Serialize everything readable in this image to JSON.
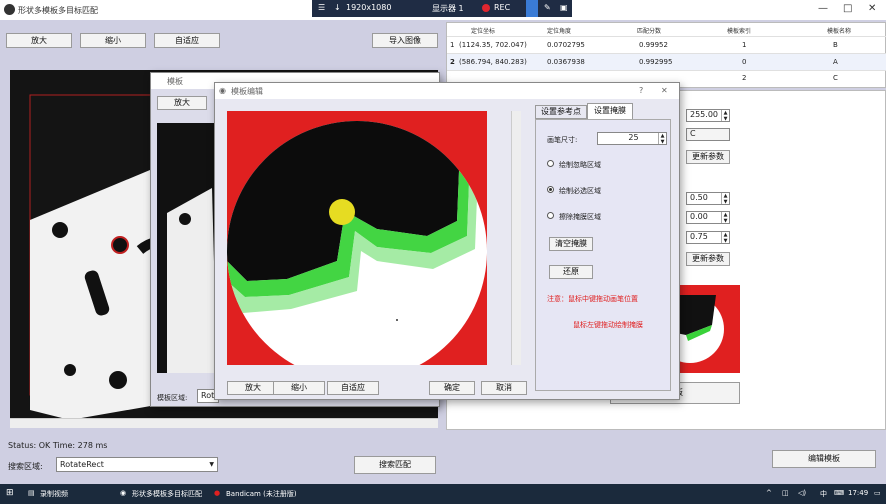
{
  "titlebar": {
    "title": "形状多模板多目标匹配",
    "minimize": "—",
    "maximize": "□",
    "close": "✕"
  },
  "recorder": {
    "resolution": "1920x1080",
    "display": "显示器 1",
    "rec": "REC"
  },
  "toolbar": {
    "zoom_in": "放大",
    "zoom_out": "缩小",
    "fit": "自适应",
    "import_image": "导入图像"
  },
  "table": {
    "headers": [
      "定位坐标",
      "定位角度",
      "匹配分数",
      "模板索引",
      "模板名称"
    ],
    "rows": [
      {
        "idx": "1",
        "coord": "(1124.35, 702.047)",
        "angle": "0.0702795",
        "score": "0.99952",
        "index": "1",
        "name": "B"
      },
      {
        "idx": "2",
        "coord": "(586.794, 840.283)",
        "angle": "0.0367938",
        "score": "0.992995",
        "index": "0",
        "name": "A"
      },
      {
        "idx": "",
        "coord": "",
        "angle": "",
        "score": "",
        "index": "2",
        "name": "C"
      }
    ]
  },
  "right_params": {
    "val1": "255.00",
    "val2": "C",
    "update1": "更新参数",
    "val3": "0.50",
    "val4": "0.00",
    "val5": "0.75",
    "update2": "更新参数",
    "template_btn": "模板"
  },
  "template_window": {
    "title": "模板",
    "zoom_in": "放大",
    "region_label": "模板区域:",
    "region_value": "Rota"
  },
  "editor": {
    "title": "模板编辑",
    "help": "?",
    "close": "✕",
    "tab_ref": "设置参考点",
    "tab_mask": "设置掩膜",
    "brush_label": "画笔尺寸:",
    "brush_value": "25",
    "opt_ignore": "绘制忽略区域",
    "opt_required": "绘制必选区域",
    "opt_erase": "擦除掩膜区域",
    "clear_mask": "清空掩膜",
    "restore": "还原",
    "note1": "注意：鼠标中键拖动画笔位置",
    "note2": "鼠标左键拖动绘制掩膜",
    "zoom_in": "放大",
    "zoom_out": "缩小",
    "fit": "自适应",
    "ok": "确定",
    "cancel": "取消"
  },
  "status": {
    "text": "Status: OK Time: 278 ms"
  },
  "search": {
    "label": "搜索区域:",
    "value": "RotateRect",
    "search_btn": "搜索匹配",
    "edit_template": "编辑模板"
  },
  "taskbar": {
    "app1": "录制视频",
    "app2": "形状多模板多目标匹配",
    "app3": "Bandicam (未注册版)",
    "ime": "中",
    "time": "17:49"
  }
}
